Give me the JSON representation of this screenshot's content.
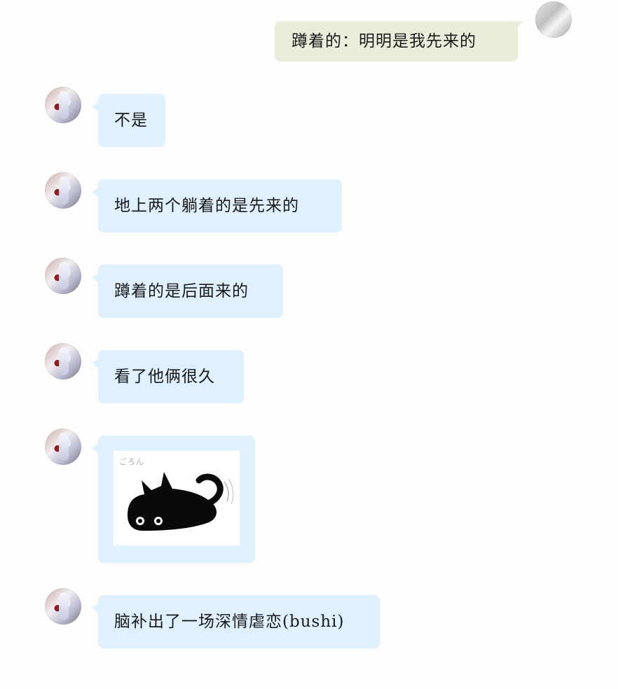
{
  "messages": [
    {
      "sender": "self",
      "text": "蹲着的：明明是我先来的"
    },
    {
      "sender": "other",
      "text": "不是"
    },
    {
      "sender": "other",
      "text": "地上两个躺着的是先来的"
    },
    {
      "sender": "other",
      "text": "蹲着的是后面来的"
    },
    {
      "sender": "other",
      "text": "看了他俩很久"
    },
    {
      "sender": "other",
      "type": "sticker",
      "sticker": "black-cat-lying-sticker",
      "scribble": "ごろん"
    },
    {
      "sender": "other",
      "text": "脑补出了一场深情虐恋(bushi)"
    }
  ],
  "colors": {
    "background": "#fdfdfd",
    "other_bubble": "#dff0fe",
    "self_bubble": "#ececdb",
    "text": "#1a1a1a"
  }
}
